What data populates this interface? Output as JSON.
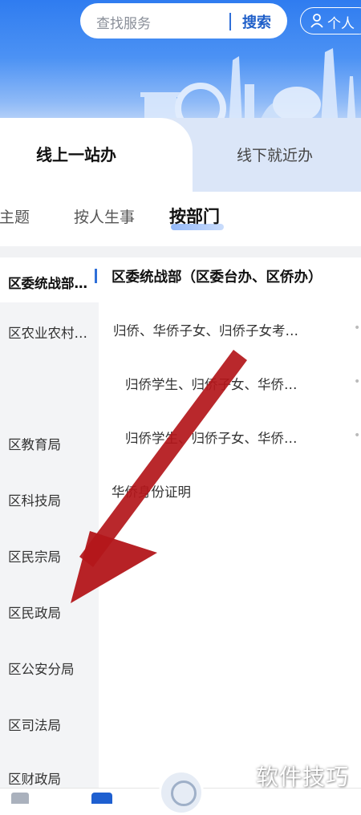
{
  "header": {
    "search_placeholder": "查找服务",
    "search_button": "搜索",
    "user_button": "个人"
  },
  "main_tabs": {
    "online": "线上一站办",
    "offline": "线下就近办"
  },
  "sub_tabs": {
    "by_theme": "按主题",
    "by_life_event": "按人生事",
    "by_department": "按部门"
  },
  "departments": [
    "区委统战部…",
    "区农业农村…",
    "区教育局",
    "区科技局",
    "区民宗局",
    "区民政局",
    "区公安分局",
    "区司法局",
    "区财政局"
  ],
  "content": {
    "title": "区委统战部（区委台办、区侨办）",
    "services": [
      "归侨、华侨子女、归侨子女考…",
      "归侨学生、归侨子女、华侨…",
      "归侨学生、归侨子女、华侨…",
      "华侨身份证明"
    ]
  },
  "watermark": "软件技巧",
  "colors": {
    "brand_blue": "#2f6fd8",
    "annotation_arrow": "#b3161a"
  }
}
